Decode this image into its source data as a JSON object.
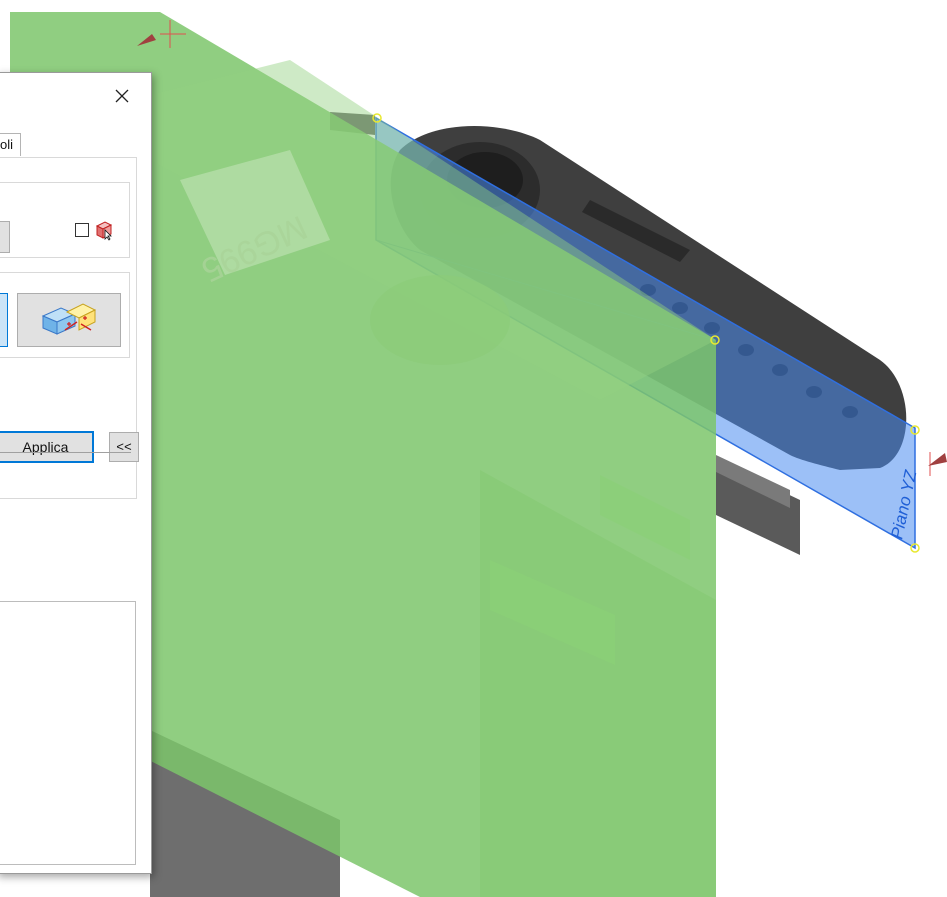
{
  "dialog": {
    "tab_label": "oli",
    "apply_label": "Applica",
    "collapse_label": "<<",
    "close_glyph": "×",
    "checkbox_checked": false
  },
  "viewport": {
    "plane_label": "Piano YZ",
    "model_engraving": "MG995",
    "colors": {
      "plane_green": "#7dc66b",
      "plane_blue": "#4a8cf0",
      "horn": "#3c3c3c",
      "body": "#6f6f6f"
    }
  },
  "icons": [
    "close-icon",
    "select-body-icon",
    "section-mode-icon"
  ]
}
